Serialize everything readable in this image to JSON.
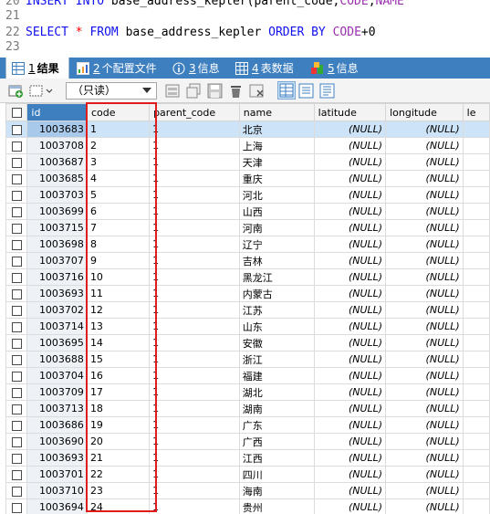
{
  "editor": {
    "lines": [
      {
        "num": "20",
        "parts": [
          [
            "kw",
            "INSERT INTO "
          ],
          [
            "id",
            "base_address_kepler(parent_code,"
          ],
          [
            "ident-c",
            "CODE"
          ],
          [
            "id",
            ","
          ],
          [
            "ident-c",
            "NAME"
          ]
        ]
      },
      {
        "num": "21",
        "parts": []
      },
      {
        "num": "22",
        "parts": [
          [
            "kw",
            "SELECT "
          ],
          [
            "op",
            "* "
          ],
          [
            "kw",
            "FROM "
          ],
          [
            "id",
            "base_address_kepler "
          ],
          [
            "kw",
            "ORDER BY "
          ],
          [
            "ident-c",
            "CODE"
          ],
          [
            "id",
            "+0"
          ]
        ]
      },
      {
        "num": "23",
        "parts": []
      }
    ]
  },
  "tabs": [
    {
      "num": "1",
      "label": "结果",
      "icon": "result-grid-icon",
      "active": true
    },
    {
      "num": "2",
      "label": "个配置文件",
      "icon": "profile-icon",
      "active": false
    },
    {
      "num": "3",
      "label": "信息",
      "icon": "info-icon",
      "active": false
    },
    {
      "num": "4",
      "label": "表数据",
      "icon": "table-data-icon",
      "active": false
    },
    {
      "num": "5",
      "label": "信息",
      "icon": "info-blocks-icon",
      "active": false
    }
  ],
  "toolbar": {
    "mode": "（只读）"
  },
  "grid": {
    "columns": [
      "",
      "id",
      "code",
      "parent_code",
      "name",
      "latitude",
      "longitude",
      "le"
    ],
    "null_text": "(NULL)",
    "rows": [
      [
        "1003683",
        "1",
        "1",
        "北京"
      ],
      [
        "1003708",
        "2",
        "1",
        "上海"
      ],
      [
        "1003687",
        "3",
        "1",
        "天津"
      ],
      [
        "1003685",
        "4",
        "1",
        "重庆"
      ],
      [
        "1003703",
        "5",
        "1",
        "河北"
      ],
      [
        "1003699",
        "6",
        "1",
        "山西"
      ],
      [
        "1003715",
        "7",
        "1",
        "河南"
      ],
      [
        "1003698",
        "8",
        "1",
        "辽宁"
      ],
      [
        "1003707",
        "9",
        "1",
        "吉林"
      ],
      [
        "1003716",
        "10",
        "1",
        "黑龙江"
      ],
      [
        "1003693",
        "11",
        "1",
        "内蒙古"
      ],
      [
        "1003702",
        "12",
        "1",
        "江苏"
      ],
      [
        "1003714",
        "13",
        "1",
        "山东"
      ],
      [
        "1003695",
        "14",
        "1",
        "安徽"
      ],
      [
        "1003688",
        "15",
        "1",
        "浙江"
      ],
      [
        "1003704",
        "16",
        "1",
        "福建"
      ],
      [
        "1003709",
        "17",
        "1",
        "湖北"
      ],
      [
        "1003713",
        "18",
        "1",
        "湖南"
      ],
      [
        "1003686",
        "19",
        "1",
        "广东"
      ],
      [
        "1003690",
        "20",
        "1",
        "广西"
      ],
      [
        "1003693",
        "21",
        "1",
        "江西"
      ],
      [
        "1003701",
        "22",
        "1",
        "四川"
      ],
      [
        "1003710",
        "23",
        "1",
        "海南"
      ],
      [
        "1003694",
        "24",
        "1",
        "贵州"
      ]
    ]
  },
  "colors": {
    "accent": "#3e7fbf",
    "highlight_border": "#e01c1c",
    "keyword": "#1010f0"
  }
}
